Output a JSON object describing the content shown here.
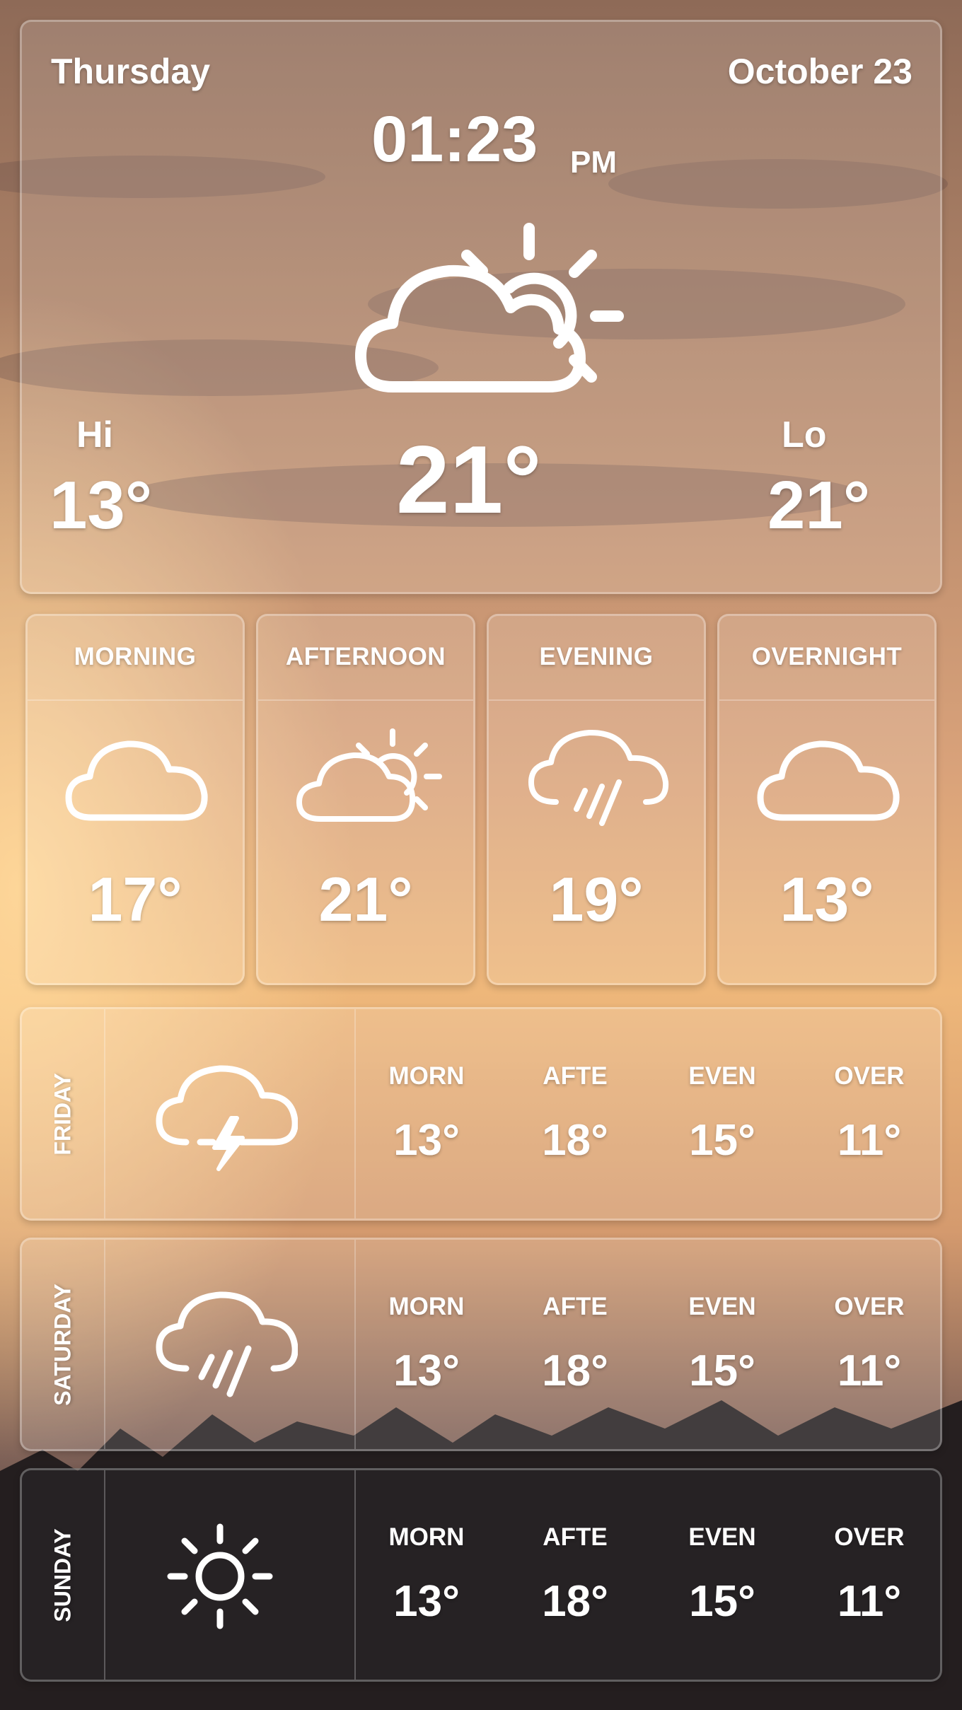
{
  "current": {
    "day": "Thursday",
    "date": "October 23",
    "time": "01:23",
    "ampm": "PM",
    "icon": "partly-cloudy-icon",
    "temperature": "21°",
    "hi_label": "Hi",
    "hi_value": "13°",
    "lo_label": "Lo",
    "lo_value": "21°"
  },
  "periods": [
    {
      "label": "MORNING",
      "icon": "cloud-icon",
      "temp": "17°"
    },
    {
      "label": "AFTERNOON",
      "icon": "partly-cloudy-icon",
      "temp": "21°"
    },
    {
      "label": "EVENING",
      "icon": "rain-icon",
      "temp": "19°"
    },
    {
      "label": "OVERNIGHT",
      "icon": "cloud-icon",
      "temp": "13°"
    }
  ],
  "forecast": [
    {
      "day": "FRIDAY",
      "icon": "thunderstorm-icon",
      "cols": [
        {
          "label": "MORN",
          "temp": "13°"
        },
        {
          "label": "AFTE",
          "temp": "18°"
        },
        {
          "label": "EVEN",
          "temp": "15°"
        },
        {
          "label": "OVER",
          "temp": "11°"
        }
      ]
    },
    {
      "day": "SATURDAY",
      "icon": "rain-icon",
      "cols": [
        {
          "label": "MORN",
          "temp": "13°"
        },
        {
          "label": "AFTE",
          "temp": "18°"
        },
        {
          "label": "EVEN",
          "temp": "15°"
        },
        {
          "label": "OVER",
          "temp": "11°"
        }
      ]
    },
    {
      "day": "SUNDAY",
      "icon": "sun-icon",
      "cols": [
        {
          "label": "MORN",
          "temp": "13°"
        },
        {
          "label": "AFTE",
          "temp": "18°"
        },
        {
          "label": "EVEN",
          "temp": "15°"
        },
        {
          "label": "OVER",
          "temp": "11°"
        }
      ]
    }
  ],
  "colors": {
    "sky_top": "#9c7258",
    "sky_glow": "#f2b970",
    "ground": "#1e1a1a",
    "text": "#ffffff"
  }
}
